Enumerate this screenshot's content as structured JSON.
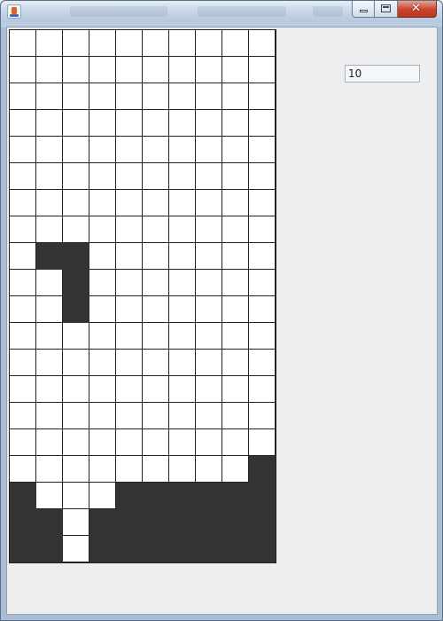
{
  "window": {
    "icon": "java-cup-icon",
    "controls": [
      "minimize-icon",
      "maximize-icon",
      "close-icon"
    ],
    "close_glyph": "✕"
  },
  "board": {
    "columns": 10,
    "rows": 20,
    "filled_color": "#333333",
    "empty_color": "#ffffff",
    "grid": [
      "0000000000",
      "0000000000",
      "0000000000",
      "0000000000",
      "0000000000",
      "0000000000",
      "0000000000",
      "0000000000",
      "0110000000",
      "0010000000",
      "0010000000",
      "0000000000",
      "0000000000",
      "0000000000",
      "0000000000",
      "0000000000",
      "0000000001",
      "1000111111",
      "1101111111",
      "1101111111"
    ]
  },
  "score": {
    "value": "10"
  }
}
